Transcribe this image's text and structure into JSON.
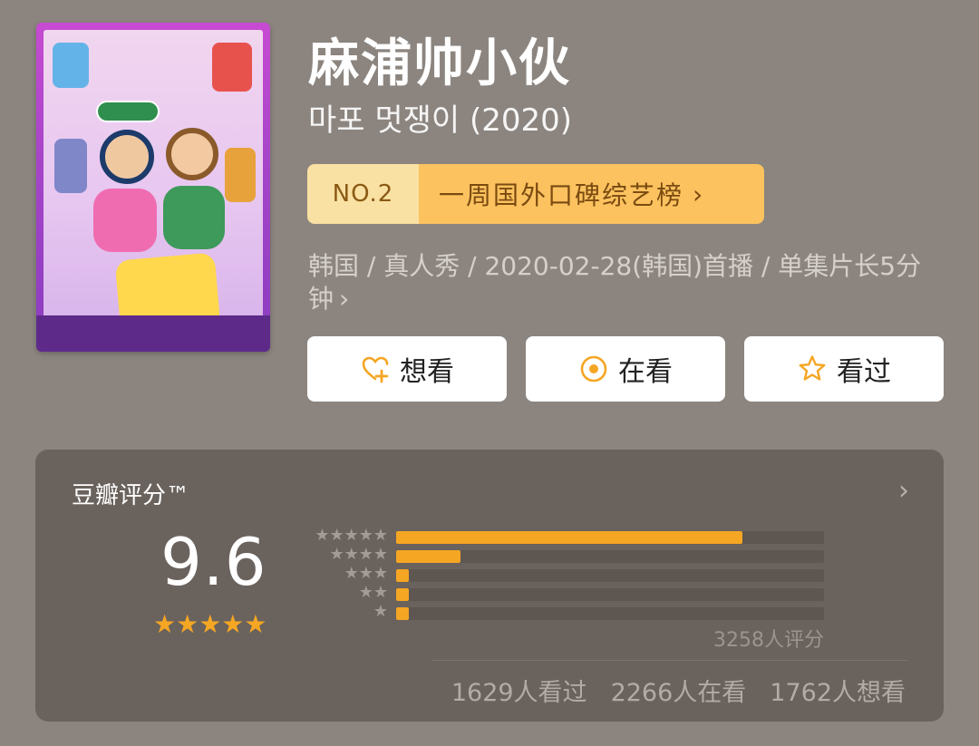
{
  "title": "麻浦帅小伙",
  "original_title": "마포 멋쟁이 (2020)",
  "rank": {
    "badge": "NO.2",
    "list_name": "一周国外口碑综艺榜",
    "chevron": "›"
  },
  "meta": {
    "text": "韩国 / 真人秀 / 2020-02-28(韩国)首播 / 单集片长5分钟",
    "chevron": "›"
  },
  "actions": {
    "want": "想看",
    "watching": "在看",
    "watched": "看过"
  },
  "rating": {
    "label": "豆瓣评分™",
    "chevron": "›",
    "score": "9.6",
    "score_stars": "★★★★★",
    "distribution": [
      {
        "stars": "★★★★★",
        "percent": 81
      },
      {
        "stars": "★★★★",
        "percent": 15
      },
      {
        "stars": "★★★",
        "percent": 3
      },
      {
        "stars": "★★",
        "percent": 3
      },
      {
        "stars": "★",
        "percent": 3
      }
    ],
    "count": "3258人评分"
  },
  "stats": {
    "watched": "1629人看过",
    "watching": "2266人在看",
    "want": "1762人想看"
  },
  "colors": {
    "background": "#8c857f",
    "card": "#6a625d",
    "accent": "#f5a623",
    "rank_badge": "#f9e0a3",
    "rank_bar": "#fbc25f"
  },
  "icons": {
    "want": "heart-plus-icon",
    "watching": "target-circle-icon",
    "watched": "star-outline-icon"
  }
}
